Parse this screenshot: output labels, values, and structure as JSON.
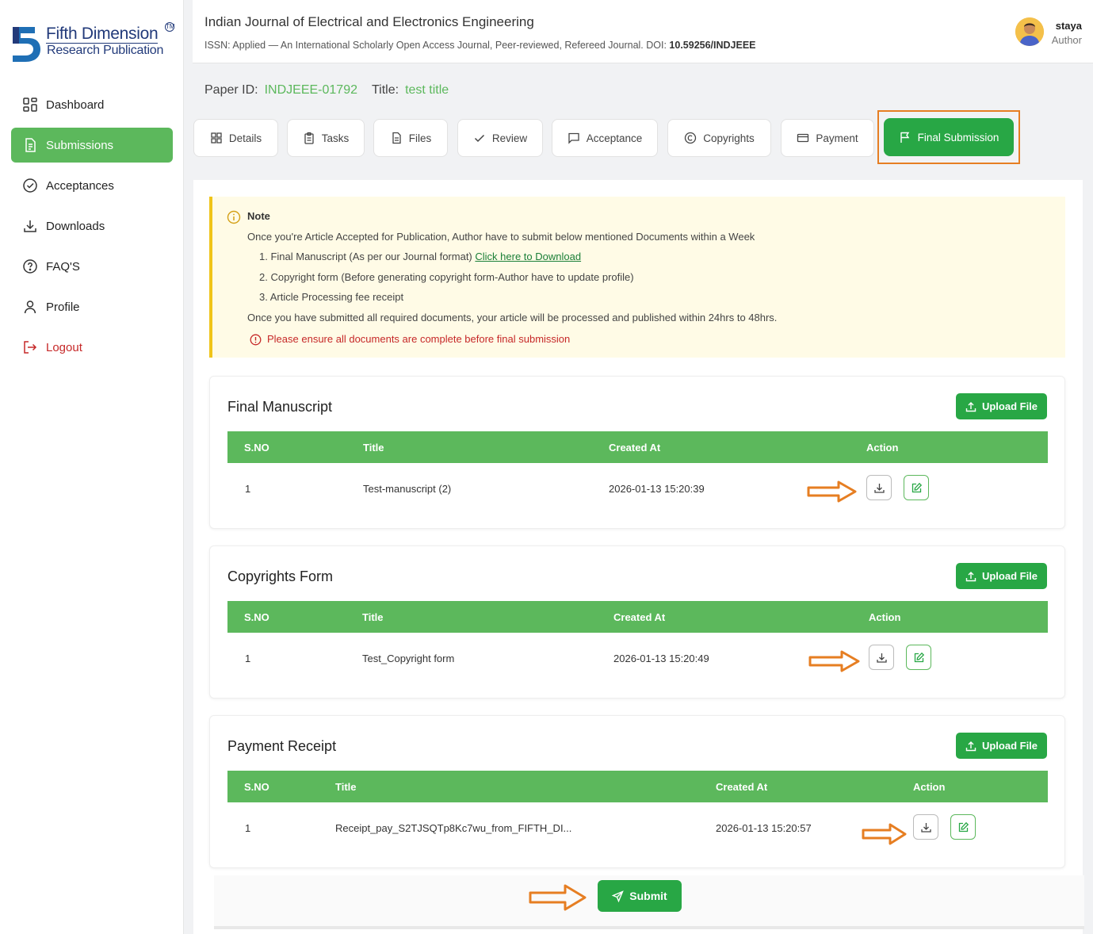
{
  "brand": {
    "name": "Fifth Dimension",
    "tagline": "Research Publication",
    "tm": "TM",
    "color": "#223a7a"
  },
  "sidebar": {
    "items": [
      {
        "label": "Dashboard",
        "icon": "grid-icon"
      },
      {
        "label": "Submissions",
        "icon": "document-icon",
        "active": true
      },
      {
        "label": "Acceptances",
        "icon": "check-circle-icon"
      },
      {
        "label": "Downloads",
        "icon": "download-icon"
      },
      {
        "label": "FAQ'S",
        "icon": "question-circle-icon"
      },
      {
        "label": "Profile",
        "icon": "user-icon"
      },
      {
        "label": "Logout",
        "icon": "logout-icon"
      }
    ]
  },
  "header": {
    "title": "Indian Journal of Electrical and Electronics Engineering",
    "subtitle": "ISSN: Applied — An International Scholarly Open Access Journal, Peer-reviewed, Refereed Journal. DOI: ",
    "doi": "10.59256/INDJEEE",
    "user": {
      "name": "staya",
      "role": "Author"
    }
  },
  "paper": {
    "id_label": "Paper ID:",
    "id": "INDJEEE-01792",
    "title_label": "Title:",
    "title": "test title"
  },
  "tabs": [
    {
      "label": "Details",
      "icon": "grid-icon"
    },
    {
      "label": "Tasks",
      "icon": "clipboard-icon"
    },
    {
      "label": "Files",
      "icon": "file-icon"
    },
    {
      "label": "Review",
      "icon": "check-icon"
    },
    {
      "label": "Acceptance",
      "icon": "message-icon"
    },
    {
      "label": "Copyrights",
      "icon": "copyright-icon"
    },
    {
      "label": "Payment",
      "icon": "credit-card-icon"
    },
    {
      "label": "Final Submission",
      "icon": "flag-icon",
      "active": true
    }
  ],
  "note": {
    "title": "Note",
    "intro": "Once you're Article Accepted for Publication, Author have to submit below mentioned Documents within a Week",
    "item1": "1. Final Manuscript (As per our Journal format) ",
    "item1_link": "Click here to Download",
    "item2": "2. Copyright form (Before generating copyright form-Author have to update profile)",
    "item3": "3. Article Processing fee receipt",
    "outro": "Once you have submitted all required documents, your article will be processed and published within 24hrs to 48hrs.",
    "warning": "Please ensure all documents are complete before final submission"
  },
  "table_headers": {
    "sno": "S.NO",
    "title": "Title",
    "created": "Created At",
    "action": "Action"
  },
  "upload_label": "Upload File",
  "sections": [
    {
      "title": "Final Manuscript",
      "row": {
        "sno": "1",
        "title": "Test-manuscript (2)",
        "created": "2026-01-13 15:20:39"
      }
    },
    {
      "title": "Copyrights Form",
      "row": {
        "sno": "1",
        "title": "Test_Copyright form",
        "created": "2026-01-13 15:20:49"
      }
    },
    {
      "title": "Payment Receipt",
      "row": {
        "sno": "1",
        "title": "Receipt_pay_S2TJSQTp8Kc7wu_from_FIFTH_DI...",
        "created": "2026-01-13 15:20:57"
      }
    }
  ],
  "submit_label": "Submit",
  "colors": {
    "green": "#28a745",
    "green_light": "#5cb85c",
    "annotation": "#e67e22",
    "warning": "#c62828"
  }
}
